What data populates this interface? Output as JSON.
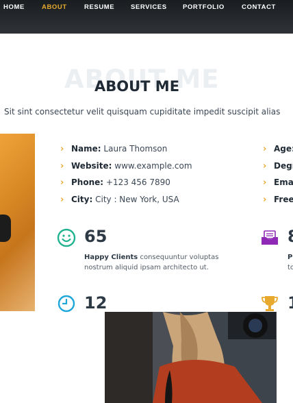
{
  "nav": {
    "items": [
      "HOME",
      "ABOUT",
      "RESUME",
      "SERVICES",
      "PORTFOLIO",
      "CONTACT"
    ],
    "active": "ABOUT",
    "active_color": "#e8a92f"
  },
  "section": {
    "title_bg": "ABOUT ME",
    "title": "ABOUT ME",
    "subtitle": "Sit sint consectetur velit quisquam cupiditate impedit suscipit alias"
  },
  "info_left": [
    {
      "label": "Name:",
      "value": "Laura Thomson"
    },
    {
      "label": "Website:",
      "value": "www.example.com"
    },
    {
      "label": "Phone:",
      "value": "+123 456 7890"
    },
    {
      "label": "City:",
      "value": "City : New York, USA"
    }
  ],
  "info_right": [
    {
      "label": "Age:"
    },
    {
      "label": "Degr"
    },
    {
      "label": "Ema"
    },
    {
      "label": "Free"
    }
  ],
  "stats": [
    {
      "icon": "smiley-icon",
      "number": "65",
      "title": "Happy Clients",
      "text": "consequuntur voluptas nostrum aliquid ipsam architecto ut."
    },
    {
      "icon": "inbox-icon",
      "number": "8",
      "title": "P",
      "text": "to"
    },
    {
      "icon": "clock-icon",
      "number": "12"
    },
    {
      "icon": "trophy-icon",
      "number": "1"
    }
  ],
  "colors": {
    "nav_bg": "#2b2f33",
    "accent": "#e8a92f",
    "teal": "#21b38f",
    "blue": "#1da7d8",
    "purple": "#8e2ab6"
  }
}
